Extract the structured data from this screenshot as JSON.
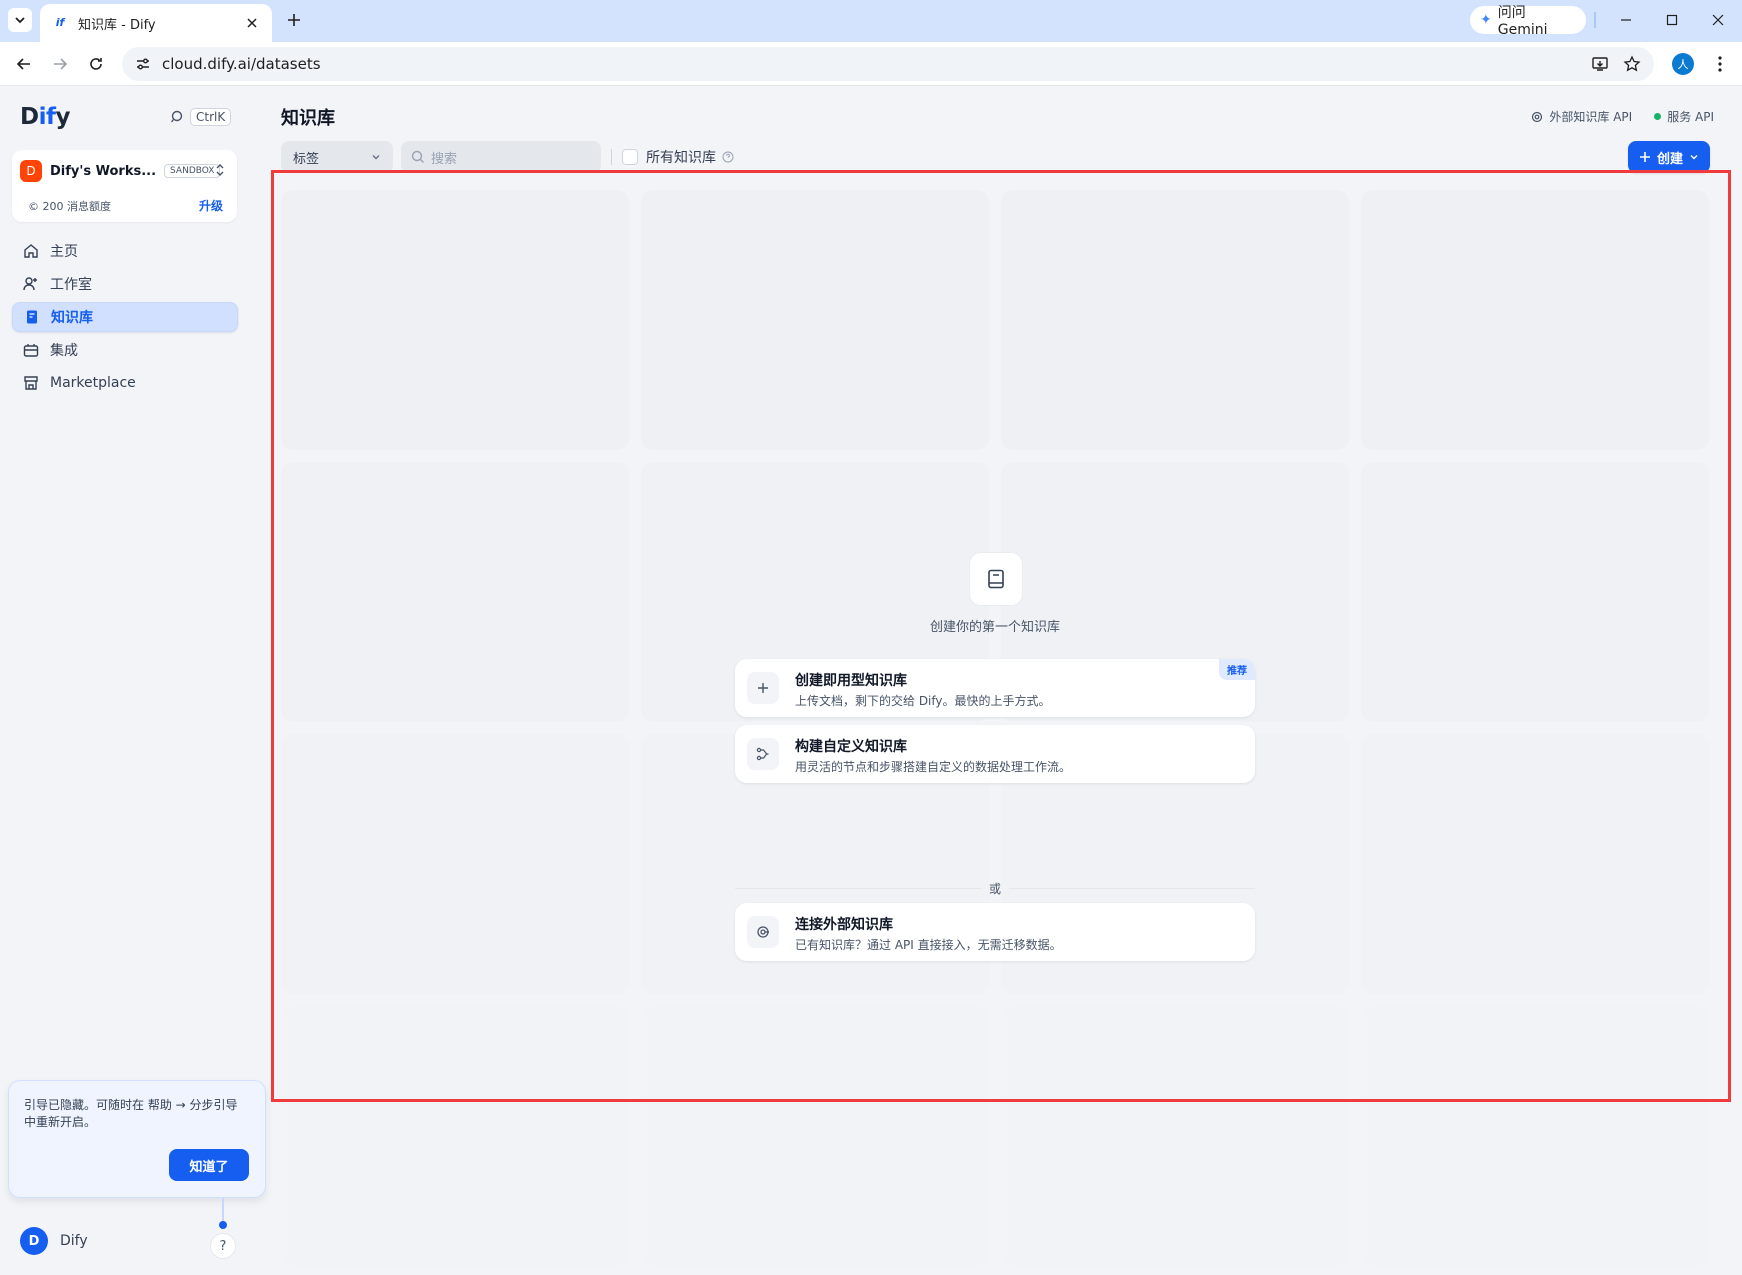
{
  "browser": {
    "tab_title": "知识库 - Dify",
    "favicon_text": "if",
    "url": "cloud.dify.ai/datasets",
    "gemini_label": "问问 Gemini",
    "profile_initial": "人"
  },
  "sidebar": {
    "logo_prefix": "D",
    "logo_mid": "if",
    "logo_suffix": "y",
    "search_shortcut": "CtrlK",
    "workspace": {
      "avatar": "D",
      "name": "Dify's Works...",
      "plan_badge": "SANDBOX",
      "quota": "© 200 消息额度",
      "upgrade": "升级"
    },
    "items": [
      {
        "label": "主页",
        "icon": "home-icon"
      },
      {
        "label": "工作室",
        "icon": "studio-icon"
      },
      {
        "label": "知识库",
        "icon": "knowledge-icon",
        "active": true
      },
      {
        "label": "集成",
        "icon": "integration-icon"
      },
      {
        "label": "Marketplace",
        "icon": "marketplace-icon"
      }
    ],
    "guide": {
      "text": "引导已隐藏。可随时在 帮助 → 分步引导 中重新开启。",
      "button": "知道了"
    },
    "user": {
      "avatar": "D",
      "name": "Dify"
    },
    "help": "?"
  },
  "main": {
    "title": "知识库",
    "external_api": "外部知识库 API",
    "service_api": "服务 API",
    "tag_select": "标签",
    "search_placeholder": "搜索",
    "all_datasets": "所有知识库",
    "create": "创建",
    "empty": {
      "text": "创建你的第一个知识库",
      "options": [
        {
          "title": "创建即用型知识库",
          "desc": "上传文档，剩下的交给 Dify。最快的上手方式。",
          "badge": "推荐",
          "icon": "plus-icon"
        },
        {
          "title": "构建自定义知识库",
          "desc": "用灵活的节点和步骤搭建自定义的数据处理工作流。",
          "icon": "pipeline-icon"
        },
        {
          "title": "连接外部知识库",
          "desc": "已有知识库？通过 API 直接接入，无需迁移数据。",
          "icon": "external-api-icon"
        }
      ],
      "or": "或"
    }
  },
  "colors": {
    "accent": "#155eef",
    "highlight_border": "#ef3b3b",
    "sidebar_active": "#d1e0ff"
  }
}
